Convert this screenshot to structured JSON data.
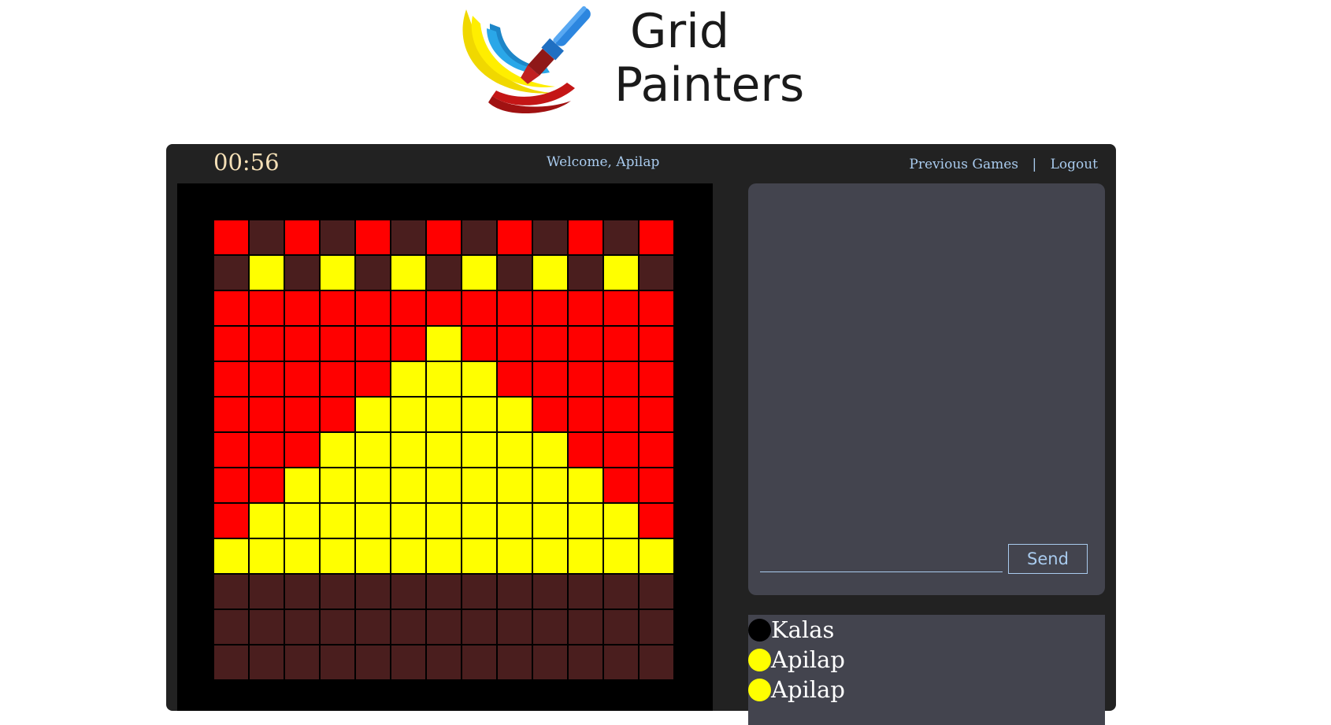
{
  "logo": {
    "line1": "Grid",
    "line2": "Painters"
  },
  "header": {
    "timer": "00:56",
    "welcome": "Welcome, Apilap",
    "nav": {
      "previous_games": "Previous Games",
      "separator": "|",
      "logout": "Logout"
    }
  },
  "palette": {
    "R": "#ff0000",
    "D": "#4a1e1e",
    "Y": "#ffff00"
  },
  "board": {
    "rows": 13,
    "cols": 13,
    "cells": [
      "RDRDRDRDRDRDR",
      "DYDYDYDYDYDYD",
      "RRRRRRRRRRRRR",
      "RRRRRRYRRRRRR",
      "RRRRRYYYRRRRR",
      "RRRRYYYYYRRRR",
      "RRRYYYYYYYRRR",
      "RRYYYYYYYYYRR",
      "RYYYYYYYYYYYR",
      "YYYYYYYYYYYYY",
      "DDDDDDDDDDDDD",
      "DDDDDDDDDDDDD",
      "DDDDDDDDDDDDD"
    ]
  },
  "chat": {
    "input_value": "",
    "send_label": "Send"
  },
  "players": [
    {
      "name": "Kalas",
      "color": "#000000"
    },
    {
      "name": "Apilap",
      "color": "#ffff00"
    },
    {
      "name": "Apilap",
      "color": "#ffff00"
    }
  ]
}
